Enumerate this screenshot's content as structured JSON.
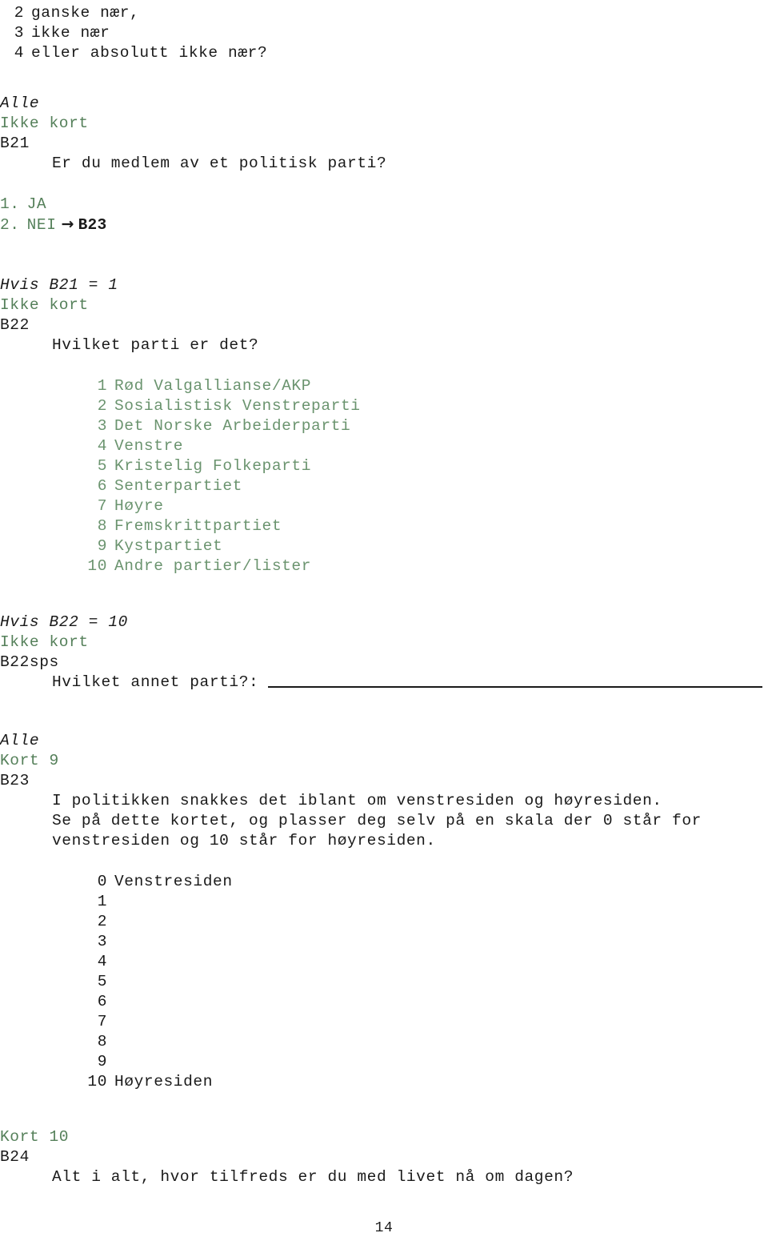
{
  "document": {
    "page_number": "14",
    "language": "Norwegian",
    "colors": {
      "green": "#55805a",
      "black": "#1a1a1a",
      "page_background": "#ffffff"
    }
  },
  "continued_options": {
    "items": [
      {
        "num": "2",
        "label": "ganske nær,"
      },
      {
        "num": "3",
        "label": "ikke nær"
      },
      {
        "num": "4",
        "label": "eller absolutt ikke nær?"
      }
    ]
  },
  "b21": {
    "filter": "Alle",
    "card": "Ikke kort",
    "id": "B21",
    "question": "Er du medlem av et politisk parti?",
    "answers": [
      {
        "num": "1.",
        "label": "JA",
        "goto": ""
      },
      {
        "num": "2.",
        "label": "NEI",
        "arrow": "→",
        "goto": "B23"
      }
    ]
  },
  "b22": {
    "filter": "Hvis B21 = 1",
    "card": "Ikke kort",
    "id": "B22",
    "question": "Hvilket parti er det?",
    "options": [
      {
        "num": "1",
        "label": "Rød Valgallianse/AKP"
      },
      {
        "num": "2",
        "label": "Sosialistisk Venstreparti"
      },
      {
        "num": "3",
        "label": "Det Norske Arbeiderparti"
      },
      {
        "num": "4",
        "label": "Venstre"
      },
      {
        "num": "5",
        "label": "Kristelig Folkeparti"
      },
      {
        "num": "6",
        "label": "Senterpartiet"
      },
      {
        "num": "7",
        "label": "Høyre"
      },
      {
        "num": "8",
        "label": "Fremskrittpartiet"
      },
      {
        "num": "9",
        "label": "Kystpartiet"
      },
      {
        "num": "10",
        "label": "Andre partier/lister"
      }
    ]
  },
  "b22sps": {
    "filter": "Hvis B22 = 10",
    "card": "Ikke kort",
    "id": "B22sps",
    "question": "Hvilket annet parti?:"
  },
  "b23": {
    "filter": "Alle",
    "card": "Kort 9",
    "id": "B23",
    "question_lines": [
      "I politikken snakkes det iblant om venstresiden og høyresiden.",
      "Se på dette kortet, og plasser deg selv på en skala der 0 står for",
      "venstresiden og 10 står for høyresiden."
    ],
    "scale": [
      {
        "num": "0",
        "label": "Venstresiden"
      },
      {
        "num": "1",
        "label": ""
      },
      {
        "num": "2",
        "label": ""
      },
      {
        "num": "3",
        "label": ""
      },
      {
        "num": "4",
        "label": ""
      },
      {
        "num": "5",
        "label": ""
      },
      {
        "num": "6",
        "label": ""
      },
      {
        "num": "7",
        "label": ""
      },
      {
        "num": "8",
        "label": ""
      },
      {
        "num": "9",
        "label": ""
      },
      {
        "num": "10",
        "label": "Høyresiden"
      }
    ]
  },
  "b24": {
    "card": "Kort 10",
    "id": "B24",
    "question": "Alt i alt, hvor tilfreds er du med livet nå om dagen?"
  }
}
